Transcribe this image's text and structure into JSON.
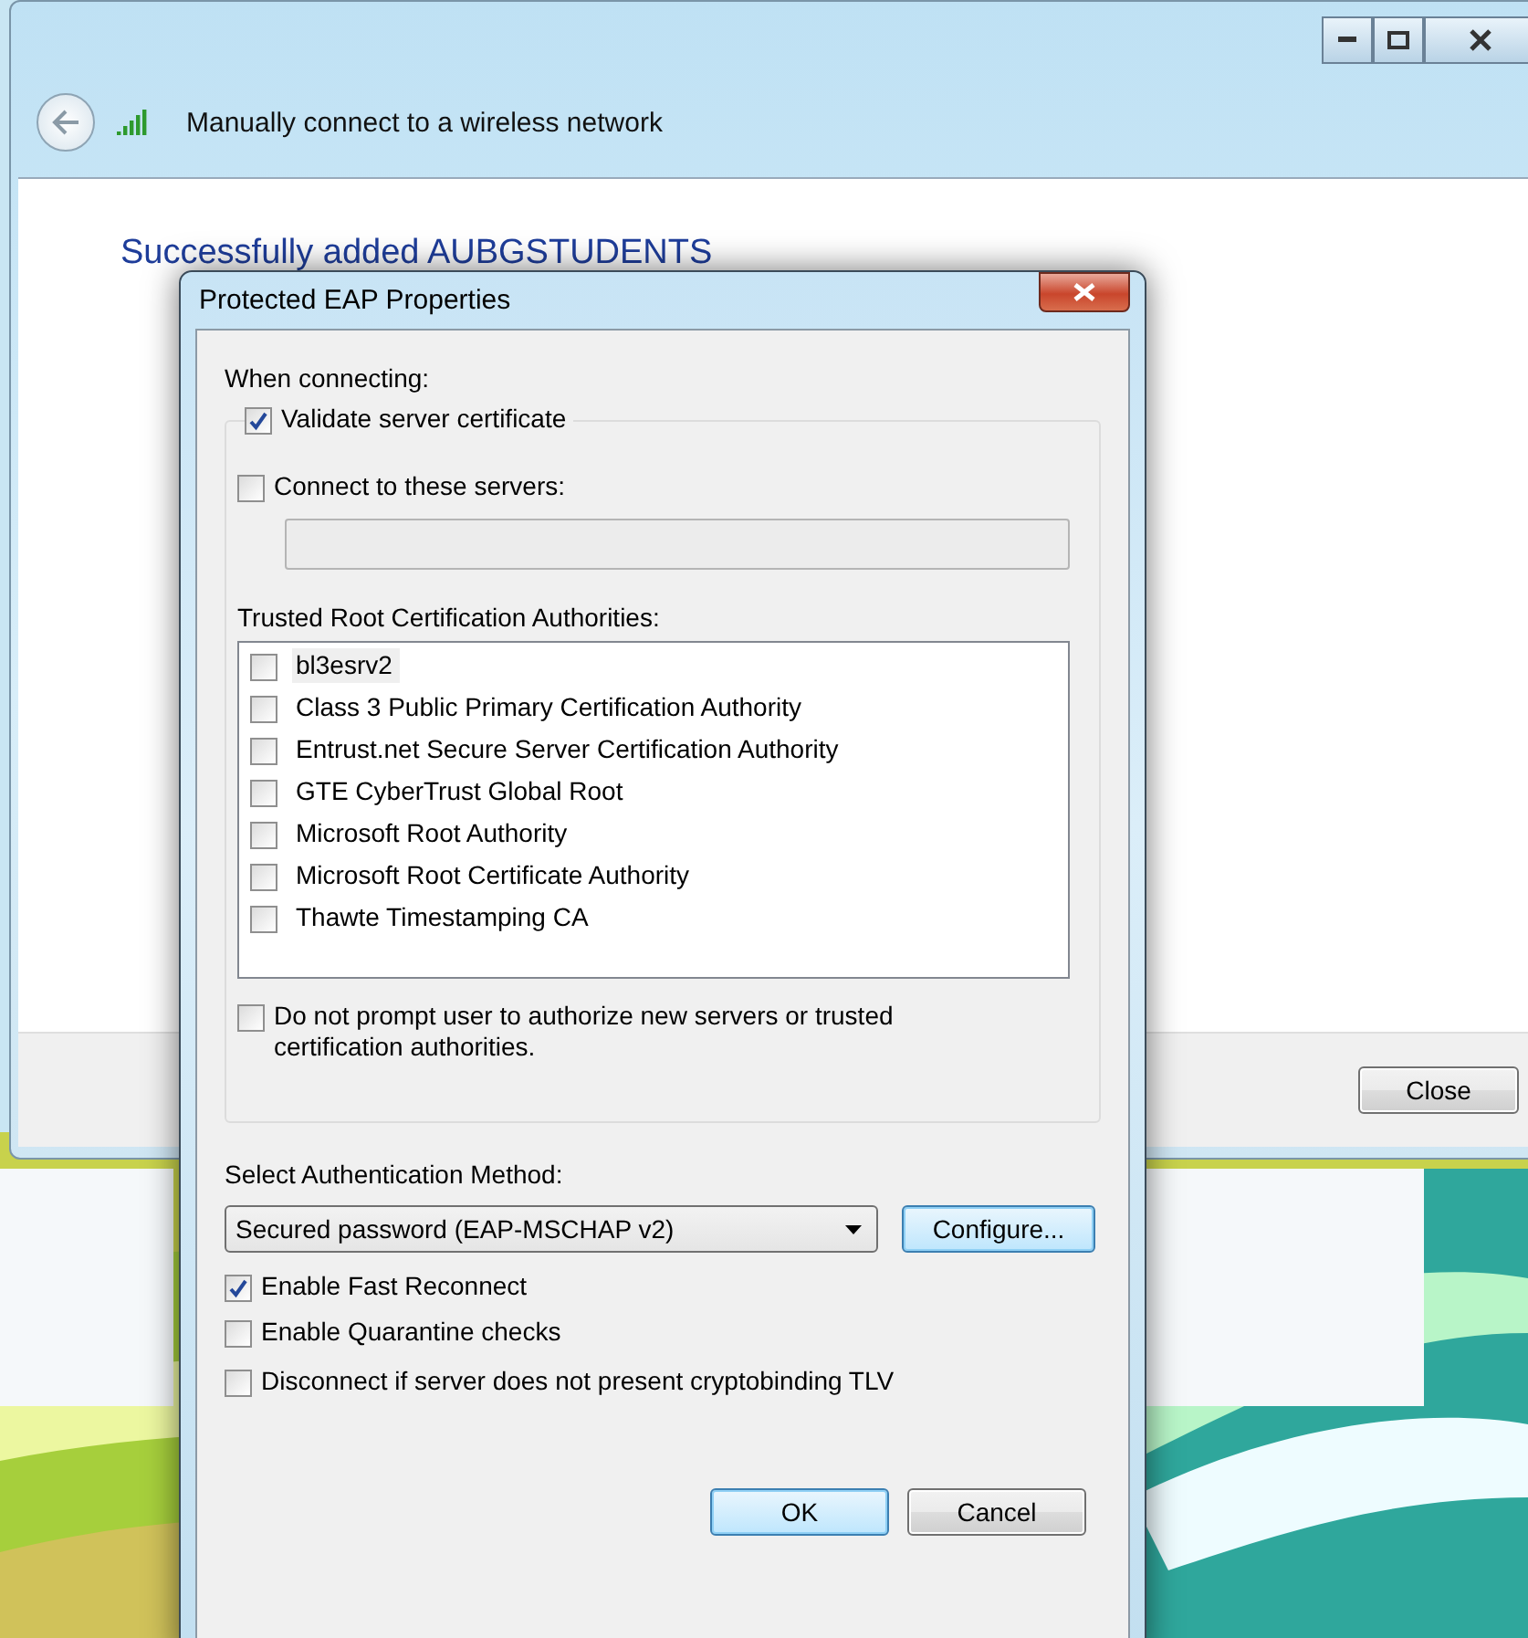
{
  "background_window": {
    "title": "Manually connect to a wireless network",
    "heading": "Successfully added AUBGSTUDENTS",
    "close_button": "Close"
  },
  "dialog": {
    "title": "Protected EAP Properties",
    "when_connecting": "When connecting:",
    "validate": {
      "label": "Validate server certificate",
      "checked": true
    },
    "connect_servers": {
      "label": "Connect to these servers:",
      "checked": false
    },
    "trusted_label": "Trusted Root Certification Authorities:",
    "authorities": [
      {
        "name": "bl3esrv2",
        "checked": false,
        "selected": true
      },
      {
        "name": "Class 3 Public Primary Certification Authority",
        "checked": false,
        "selected": false
      },
      {
        "name": "Entrust.net Secure Server Certification Authority",
        "checked": false,
        "selected": false
      },
      {
        "name": "GTE CyberTrust Global Root",
        "checked": false,
        "selected": false
      },
      {
        "name": "Microsoft Root Authority",
        "checked": false,
        "selected": false
      },
      {
        "name": "Microsoft Root Certificate Authority",
        "checked": false,
        "selected": false
      },
      {
        "name": "Thawte Timestamping CA",
        "checked": false,
        "selected": false
      }
    ],
    "do_not_prompt": {
      "label": "Do not prompt user to authorize new servers or trusted certification authorities.",
      "checked": false
    },
    "auth_method_label": "Select Authentication Method:",
    "auth_method": "Secured password (EAP-MSCHAP v2)",
    "configure_button": "Configure...",
    "options": [
      {
        "label": "Enable Fast Reconnect",
        "checked": true
      },
      {
        "label": "Enable Quarantine checks",
        "checked": false
      },
      {
        "label": "Disconnect if server does not present cryptobinding TLV",
        "checked": false
      }
    ],
    "buttons": [
      {
        "label": "OK",
        "default": true
      },
      {
        "label": "Cancel",
        "default": false
      }
    ]
  }
}
